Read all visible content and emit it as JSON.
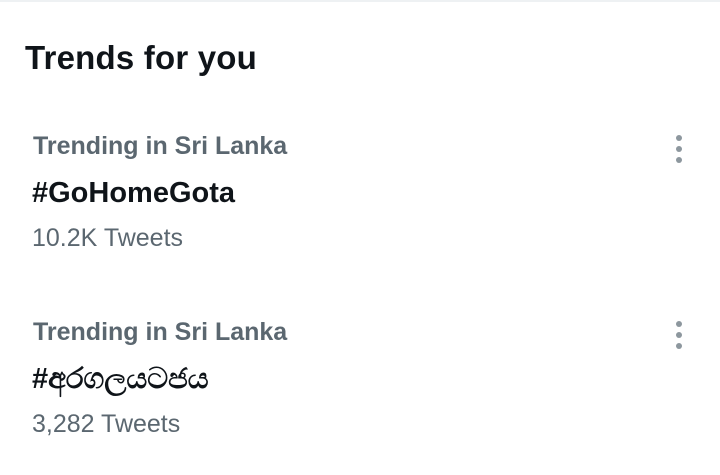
{
  "panel": {
    "title": "Trends for you"
  },
  "trends": [
    {
      "context": "Trending in Sri Lanka",
      "name": "#GoHomeGota",
      "count": "10.2K Tweets",
      "more_icon": "more-vertical-icon"
    },
    {
      "context": "Trending in Sri Lanka",
      "name": "#අරගලයටජය",
      "count": "3,282 Tweets",
      "more_icon": "more-vertical-icon"
    }
  ],
  "colors": {
    "primary_text": "#0f1419",
    "secondary_text": "#5b6770",
    "icon": "#8d979e",
    "divider": "#eef1f3",
    "background": "#ffffff"
  }
}
